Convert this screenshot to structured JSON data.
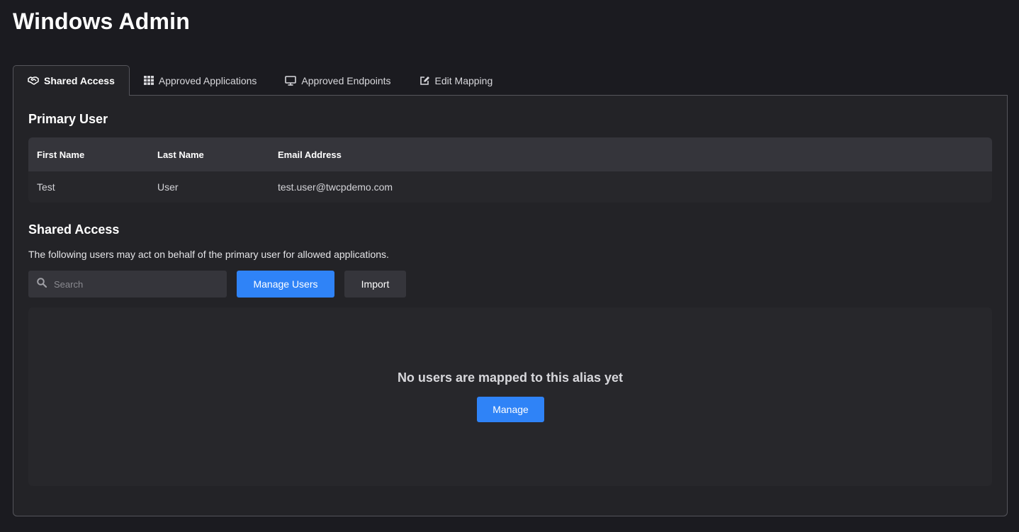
{
  "app": {
    "title": "Windows Admin"
  },
  "tabs": [
    {
      "label": "Shared Access",
      "icon": "handshake-icon",
      "active": true
    },
    {
      "label": "Approved Applications",
      "icon": "grid-icon",
      "active": false
    },
    {
      "label": "Approved Endpoints",
      "icon": "monitor-icon",
      "active": false
    },
    {
      "label": "Edit Mapping",
      "icon": "edit-icon",
      "active": false
    }
  ],
  "primary_user": {
    "title": "Primary User",
    "columns": [
      "First Name",
      "Last Name",
      "Email Address"
    ],
    "rows": [
      [
        "Test",
        "User",
        "test.user@twcpdemo.com"
      ]
    ]
  },
  "shared_access": {
    "title": "Shared Access",
    "description": "The following users may act on behalf of the primary user for allowed applications.",
    "search_placeholder": "Search",
    "manage_users_label": "Manage Users",
    "import_label": "Import",
    "empty_message": "No users are mapped to this alias yet",
    "manage_label": "Manage"
  },
  "colors": {
    "background": "#1b1b20",
    "panel": "#232327",
    "accent": "#2f83f7"
  }
}
